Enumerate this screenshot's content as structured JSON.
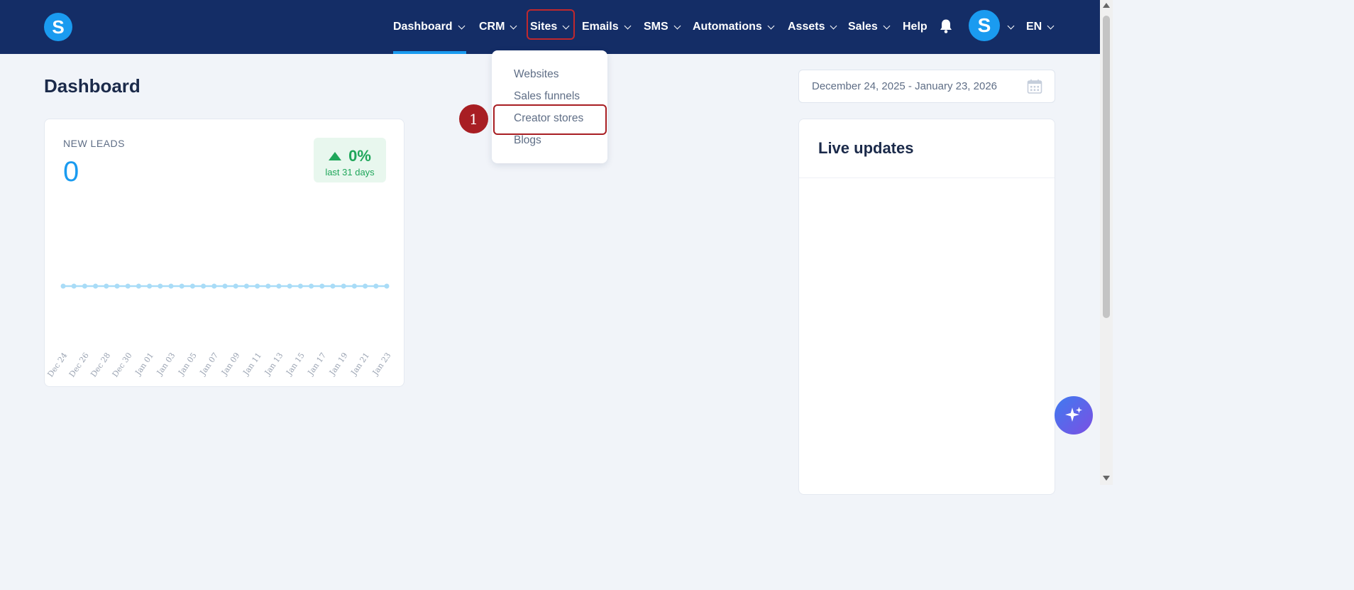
{
  "header": {
    "logo_letter": "S",
    "nav": [
      {
        "label": "Dashboard",
        "has_dropdown": true,
        "active": true
      },
      {
        "label": "CRM",
        "has_dropdown": true
      },
      {
        "label": "Sites",
        "has_dropdown": true,
        "open": true
      },
      {
        "label": "Emails",
        "has_dropdown": true
      },
      {
        "label": "SMS",
        "has_dropdown": true
      },
      {
        "label": "Automations",
        "has_dropdown": true
      },
      {
        "label": "Assets",
        "has_dropdown": true
      },
      {
        "label": "Sales",
        "has_dropdown": true
      },
      {
        "label": "Help",
        "has_dropdown": false
      }
    ],
    "avatar_letter": "S",
    "language": "EN"
  },
  "sites_menu": {
    "items": [
      "Websites",
      "Sales funnels",
      "Creator stores",
      "Blogs"
    ],
    "highlighted": "Creator stores"
  },
  "step_marker": "1",
  "page": {
    "title": "Dashboard",
    "date_range": "December 24, 2025 - January 23, 2026"
  },
  "leads": {
    "label": "NEW LEADS",
    "value": "0",
    "change": "0%",
    "period": "last 31 days"
  },
  "chart_data": {
    "type": "line",
    "x": [
      "Dec 24",
      "Dec 25",
      "Dec 26",
      "Dec 27",
      "Dec 28",
      "Dec 29",
      "Dec 30",
      "Dec 31",
      "Jan 01",
      "Jan 02",
      "Jan 03",
      "Jan 04",
      "Jan 05",
      "Jan 06",
      "Jan 07",
      "Jan 08",
      "Jan 09",
      "Jan 10",
      "Jan 11",
      "Jan 12",
      "Jan 13",
      "Jan 14",
      "Jan 15",
      "Jan 16",
      "Jan 17",
      "Jan 18",
      "Jan 19",
      "Jan 20",
      "Jan 21",
      "Jan 22",
      "Jan 23"
    ],
    "tick_labels": [
      "Dec 24",
      "Dec 26",
      "Dec 28",
      "Dec 30",
      "Jan 01",
      "Jan 03",
      "Jan 05",
      "Jan 07",
      "Jan 09",
      "Jan 11",
      "Jan 13",
      "Jan 15",
      "Jan 17",
      "Jan 19",
      "Jan 21",
      "Jan 23"
    ],
    "series": [
      {
        "values": [
          0,
          0,
          0,
          0,
          0,
          0,
          0,
          0,
          0,
          0,
          0,
          0,
          0,
          0,
          0,
          0,
          0,
          0,
          0,
          0,
          0,
          0,
          0,
          0,
          0,
          0,
          0,
          0,
          0,
          0,
          0
        ]
      }
    ],
    "ylim": [
      -1,
      1
    ],
    "grid": false,
    "color": "#a9dcf7"
  },
  "live": {
    "title": "Live updates"
  },
  "colors": {
    "nav_bg": "#142d66",
    "accent": "#1a9bf0",
    "positive": "#1fa65a",
    "highlight": "#a81e23"
  }
}
